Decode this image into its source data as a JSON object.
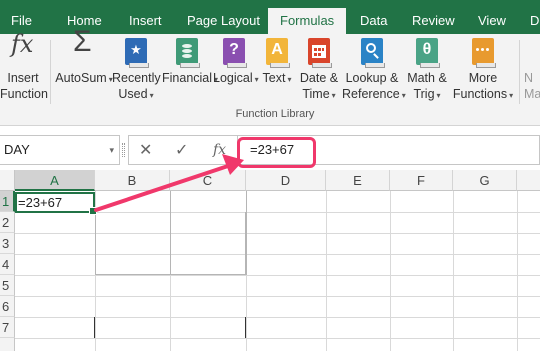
{
  "tabs": [
    {
      "label": "File",
      "active": false
    },
    {
      "label": "Home",
      "active": false
    },
    {
      "label": "Insert",
      "active": false
    },
    {
      "label": "Page Layout",
      "active": false
    },
    {
      "label": "Formulas",
      "active": true
    },
    {
      "label": "Data",
      "active": false
    },
    {
      "label": "Review",
      "active": false
    },
    {
      "label": "View",
      "active": false
    },
    {
      "label": "D",
      "active": false
    }
  ],
  "ribbon": {
    "insert_function": {
      "line1": "Insert",
      "line2": "Function",
      "icon": "fx-icon"
    },
    "autosum": {
      "line1": "AutoSum",
      "icon": "sigma-icon"
    },
    "recently_used": {
      "line1": "Recently",
      "line2": "Used",
      "icon": "star-book-icon"
    },
    "financial": {
      "line1": "Financial",
      "icon": "coins-book-icon"
    },
    "logical": {
      "line1": "Logical",
      "icon": "question-book-icon"
    },
    "text": {
      "line1": "Text",
      "icon": "a-book-icon"
    },
    "date_time": {
      "line1": "Date &",
      "line2": "Time",
      "icon": "calendar-book-icon"
    },
    "lookup_reference": {
      "line1": "Lookup &",
      "line2": "Reference",
      "icon": "magnifier-book-icon"
    },
    "math_trig": {
      "line1": "Math &",
      "line2": "Trig",
      "icon": "theta-book-icon"
    },
    "more_functions": {
      "line1": "More",
      "line2": "Functions",
      "icon": "dots-book-icon"
    },
    "name_manager_partial": {
      "line1": "N",
      "line2": "Ma"
    },
    "group_label": "Function Library",
    "symbols": {
      "fx": "fx",
      "sigma": "Σ",
      "star": "★",
      "question": "?",
      "a": "A",
      "theta": "θ",
      "caret": "▾"
    },
    "colors": {
      "recently_used": "#2e6bb5",
      "financial": "#3f9a77",
      "logical": "#8a4fb0",
      "text": "#f2b53a",
      "date_time": "#d9452b",
      "lookup_reference": "#2a83c6",
      "math_trig": "#4aa386",
      "more_functions": "#e89a2f"
    }
  },
  "formula_bar": {
    "name_box": "DAY",
    "cancel": "✕",
    "enter": "✓",
    "fx": "fx",
    "value": "=23+67"
  },
  "grid": {
    "columns": [
      "A",
      "B",
      "C",
      "D",
      "E",
      "F",
      "G"
    ],
    "rows": [
      "1",
      "2",
      "3",
      "4",
      "5",
      "6",
      "7"
    ],
    "active_cell": "A1",
    "cells": {
      "A1": "=23+67"
    }
  },
  "annotation": {
    "highlight_color": "#f0386b"
  }
}
